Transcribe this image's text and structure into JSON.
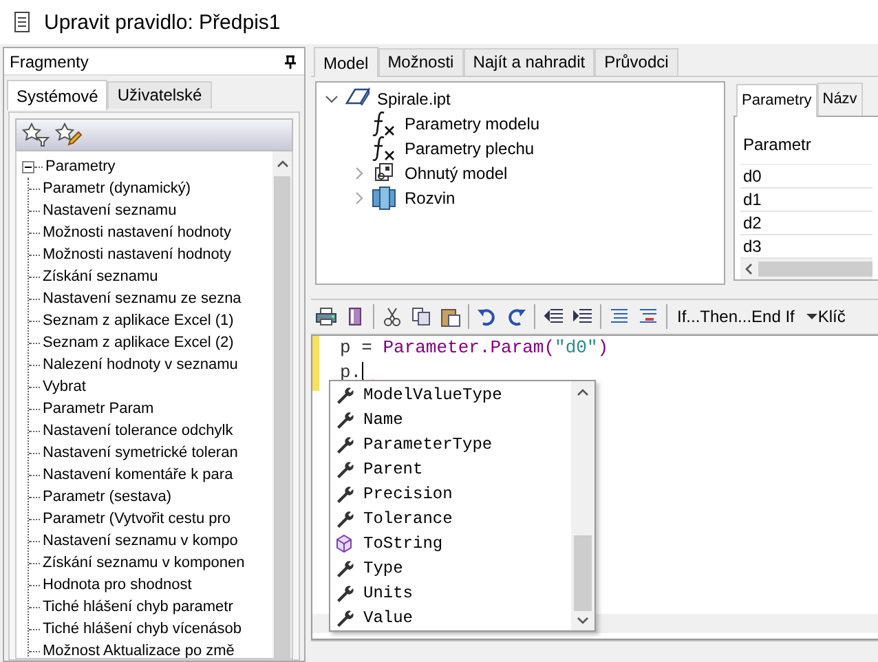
{
  "window": {
    "title": "Upravit pravidlo: Předpis1"
  },
  "fragments": {
    "title": "Fragmenty",
    "tabs": [
      {
        "label": "Systémové",
        "selected": true
      },
      {
        "label": "Uživatelské",
        "selected": false
      }
    ],
    "tree": [
      {
        "label": "Parametry",
        "expanded": true,
        "children": [
          {
            "label": "Parametr (dynamický)"
          },
          {
            "label": "Nastavení seznamu"
          },
          {
            "label": "Možnosti nastavení hodnoty"
          },
          {
            "label": "Možnosti nastavení hodnoty"
          },
          {
            "label": "Získání seznamu"
          },
          {
            "label": "Nastavení seznamu ze sezna"
          },
          {
            "label": "Seznam z aplikace Excel (1)"
          },
          {
            "label": "Seznam z aplikace Excel (2)"
          },
          {
            "label": "Nalezení hodnoty v seznamu"
          },
          {
            "label": "Vybrat"
          },
          {
            "label": "Parametr Param"
          },
          {
            "label": "Nastavení tolerance odchylk"
          },
          {
            "label": "Nastavení symetrické toleran"
          },
          {
            "label": "Nastavení komentáře k para"
          },
          {
            "label": "Parametr (sestava)"
          },
          {
            "label": "Parametr (Vytvořit cestu pro"
          },
          {
            "label": "Nastavení seznamu v kompo"
          },
          {
            "label": "Získání seznamu v komponen"
          },
          {
            "label": "Hodnota pro shodnost"
          },
          {
            "label": "Tiché hlášení chyb parametr"
          },
          {
            "label": "Tiché hlášení chyb vícenásob"
          },
          {
            "label": "Možnost Aktualizace po změ"
          }
        ]
      }
    ]
  },
  "main_tabs": [
    {
      "label": "Model",
      "selected": true
    },
    {
      "label": "Možnosti",
      "selected": false
    },
    {
      "label": "Najít a nahradit",
      "selected": false
    },
    {
      "label": "Průvodci",
      "selected": false
    }
  ],
  "model_tree": [
    {
      "label": "Spirale.ipt",
      "kind": "part",
      "expanded": true,
      "children": [
        {
          "label": "Parametry modelu",
          "kind": "formula"
        },
        {
          "label": "Parametry plechu",
          "kind": "formula"
        },
        {
          "label": "Ohnutý model",
          "kind": "folded",
          "expanded": false
        },
        {
          "label": "Rozvin",
          "kind": "flat",
          "expanded": false
        }
      ]
    }
  ],
  "parameters_panel": {
    "tabs": [
      {
        "label": "Parametry",
        "selected": true
      },
      {
        "label": "Názv",
        "selected": false
      }
    ],
    "columns": [
      "Parametr"
    ],
    "rows": [
      "d0",
      "d1",
      "d2",
      "d3"
    ]
  },
  "editor": {
    "toolbar": {
      "snippet": "If...Then...End If",
      "keyword": "Klíč"
    },
    "lines": [
      [
        {
          "text": "p = ",
          "kind": "plain"
        },
        {
          "text": "Parameter.Param(",
          "kind": "member"
        },
        {
          "text": "\"d0\"",
          "kind": "string"
        },
        {
          "text": ")",
          "kind": "member"
        }
      ],
      [
        {
          "text": "p.",
          "kind": "plain"
        }
      ]
    ]
  },
  "autocomplete": [
    {
      "label": "ModelValueType",
      "kind": "property"
    },
    {
      "label": "Name",
      "kind": "property"
    },
    {
      "label": "ParameterType",
      "kind": "property"
    },
    {
      "label": "Parent",
      "kind": "property"
    },
    {
      "label": "Precision",
      "kind": "property"
    },
    {
      "label": "Tolerance",
      "kind": "property"
    },
    {
      "label": "ToString",
      "kind": "method"
    },
    {
      "label": "Type",
      "kind": "property"
    },
    {
      "label": "Units",
      "kind": "property"
    },
    {
      "label": "Value",
      "kind": "property"
    }
  ]
}
